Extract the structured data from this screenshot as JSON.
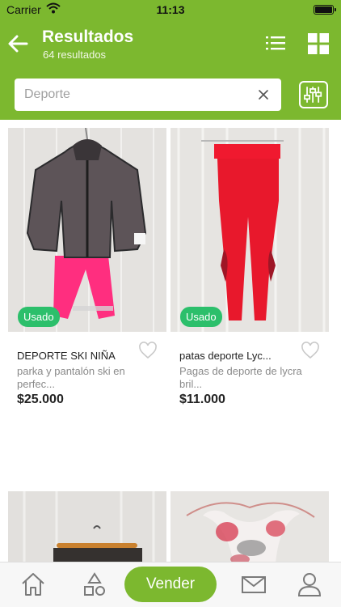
{
  "status_bar": {
    "carrier": "Carrier",
    "time": "11:13"
  },
  "header": {
    "title": "Resultados",
    "subtitle": "64 resultados"
  },
  "search": {
    "placeholder": "Deporte"
  },
  "products": [
    {
      "condition": "Usado",
      "name": "DEPORTE SKI NIÑA",
      "description": "parka y pantalón ski en perfec...",
      "price": "$25.000"
    },
    {
      "condition": "Usado",
      "name": "patas  deporte Lyc...",
      "description": "Pagas de deporte de lycra bril...",
      "price": "$11.000"
    }
  ],
  "tab_bar": {
    "sell_label": "Vender"
  },
  "icons": [
    "back-arrow-icon",
    "list-view-icon",
    "grid-view-icon",
    "clear-icon",
    "filter-icon",
    "heart-icon",
    "home-icon",
    "categories-icon",
    "mail-icon",
    "profile-icon"
  ],
  "colors": {
    "brand_green": "#7cb82f",
    "badge_green": "#2cbf6b"
  }
}
